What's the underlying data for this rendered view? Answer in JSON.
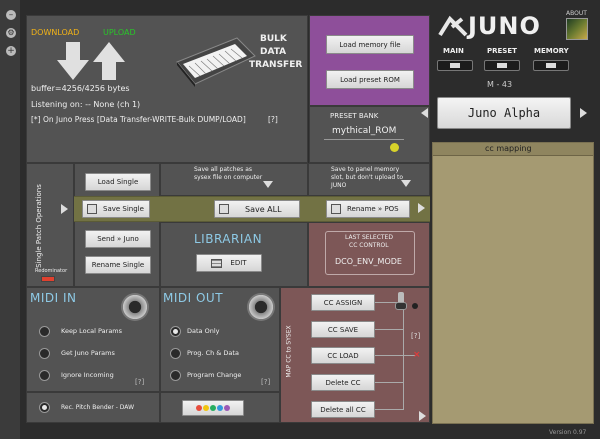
{
  "header": {
    "download_label": "DOWNLOAD",
    "upload_label": "UPLOAD",
    "buffer_text": "buffer=4256/4256 bytes",
    "listening_text": "Listening on: -- None (ch 1)",
    "instruction_text": "[*] On Juno Press [Data Transfer-WRITE-Bulk DUMP/LOAD]",
    "help": "[?]",
    "bulk_line1": "BULK",
    "bulk_line2": "DATA",
    "bulk_line3": "TRANSFER"
  },
  "memory": {
    "load_memory": "Load memory file",
    "load_preset": "Load preset ROM",
    "preset_bank_label": "PRESET BANK",
    "preset_bank_value": "mythical_ROM",
    "save_note": "Save to panel memory slot, but don't upload to JUNO",
    "rename_pos": "Rename » POS"
  },
  "right": {
    "about": "ABOUT",
    "logo_text": "JUNO",
    "main": "MAIN",
    "preset": "PRESET",
    "memory": "MEMORY",
    "patch_id": "M - 43",
    "patch_name": "Juno Alpha",
    "cc_mapping_title": "cc mapping",
    "version": "Version 0.97"
  },
  "single": {
    "side_label": "Single Patch Operations",
    "redominator": "Redominator",
    "load_single": "Load Single",
    "save_single": "Save Single",
    "send_juno": "Send » Juno",
    "rename_single": "Rename Single"
  },
  "all": {
    "save_all_note": "Save all patches as sysex file on computer",
    "save_all": "Save ALL",
    "librarian": "LIBRARIAN",
    "edit": "EDIT"
  },
  "cc_control": {
    "title_line1": "LAST SELECTED",
    "title_line2": "CC CONTROL",
    "value": "DCO_ENV_MODE"
  },
  "midi_in": {
    "title": "MIDI IN",
    "options": [
      "Keep Local Params",
      "Get Juno Params",
      "Ignore Incoming"
    ],
    "pitch_bender": "Rec. Pitch Bender - DAW",
    "help": "[?]"
  },
  "midi_out": {
    "title": "MIDI OUT",
    "options": [
      "Data Only",
      "Prog. Ch & Data",
      "Program Change"
    ],
    "help": "[?]"
  },
  "map": {
    "side_label": "MAP CC to SYSEX",
    "buttons": [
      "CC ASSIGN",
      "CC SAVE",
      "CC LOAD",
      "Delete CC",
      "Delete all CC"
    ],
    "help": "[?]"
  },
  "colors": {
    "download": "#f2b318",
    "upload": "#29c629",
    "purple": "#8e4f9a",
    "olive": "#727244",
    "mauve": "#7d5757",
    "cc_panel": "#a59a72"
  },
  "icons": {
    "down_arrow": "download-arrow-icon",
    "up_arrow": "upload-arrow-icon",
    "keyboard": "synth-keyboard-icon",
    "save": "floppy-icon",
    "edit": "stack-icon",
    "midi": "midi-port-icon",
    "colors": "color-dots-icon"
  }
}
